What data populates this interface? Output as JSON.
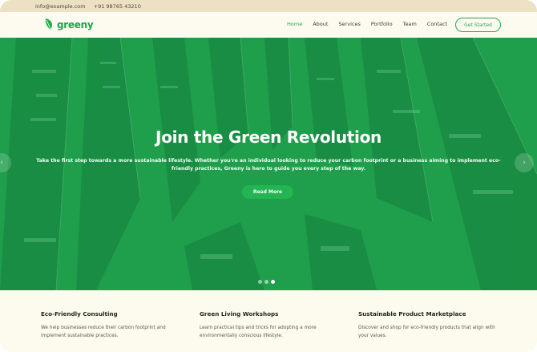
{
  "topbar": {
    "email": "info@example.com",
    "phone": "+91 98765 43210"
  },
  "header": {
    "logo_text": "greeny",
    "nav": [
      "Home",
      "About",
      "Services",
      "Portfolio",
      "Team",
      "Contact"
    ],
    "active_nav": "Home",
    "cta_label": "Get Started"
  },
  "hero": {
    "title": "Join the Green Revolution",
    "subtitle": "Take the first step towards a more sustainable lifestyle. Whether you're an individual looking to reduce your carbon footprint or a business aiming to implement eco-friendly practices, Greeny is here to guide you every step of the way.",
    "button_label": "Read More",
    "slides": 3,
    "active_slide": 3
  },
  "services": [
    {
      "title": "Eco-Friendly Consulting",
      "text": "We help businesses reduce their carbon footprint and implement sustainable practices."
    },
    {
      "title": "Green Living Workshops",
      "text": "Learn practical tips and tricks for adopting a more environmentally conscious lifestyle."
    },
    {
      "title": "Sustainable Product Marketplace",
      "text": "Discover and shop for eco-friendly products that align with your values."
    }
  ],
  "colors": {
    "accent": "#22b552",
    "hero_overlay": "#1f9e4c",
    "topbar": "#ece1c3",
    "background": "#fdfbee"
  }
}
